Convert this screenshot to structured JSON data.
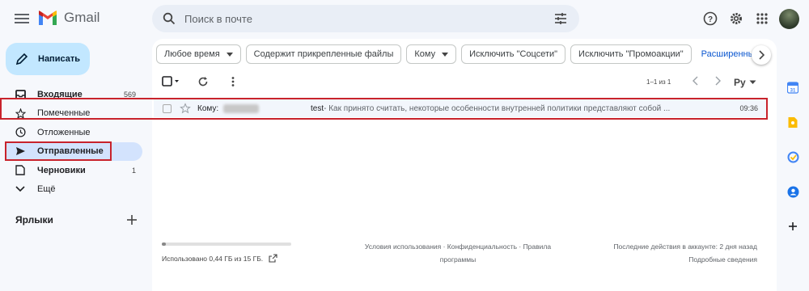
{
  "app": {
    "name": "Gmail"
  },
  "search": {
    "placeholder": "Поиск в почте"
  },
  "compose": {
    "label": "Написать"
  },
  "sidebar": {
    "items": [
      {
        "label": "Входящие",
        "count": "569",
        "icon": "inbox-icon"
      },
      {
        "label": "Помеченные",
        "count": "",
        "icon": "star-icon"
      },
      {
        "label": "Отложенные",
        "count": "",
        "icon": "clock-icon"
      },
      {
        "label": "Отправленные",
        "count": "",
        "icon": "send-icon"
      },
      {
        "label": "Черновики",
        "count": "1",
        "icon": "draft-icon"
      },
      {
        "label": "Ещё",
        "count": "",
        "icon": "chevron-down-icon"
      }
    ],
    "labels_heading": "Ярлыки"
  },
  "filters": {
    "chips": [
      {
        "label": "Любое время",
        "dropdown": true
      },
      {
        "label": "Содержит прикрепленные файлы",
        "dropdown": false
      },
      {
        "label": "Кому",
        "dropdown": true
      },
      {
        "label": "Исключить \"Соцсети\"",
        "dropdown": false
      },
      {
        "label": "Исключить \"Промоакции\"",
        "dropdown": false
      }
    ],
    "advanced_link": "Расширенны"
  },
  "toolbar": {
    "pager": "1–1 из 1",
    "input_tool": "Ру"
  },
  "messages": [
    {
      "to_label": "Кому:",
      "subject": "test",
      "snippet": " - Как принято считать, некоторые особенности внутренней политики представляют собой ...",
      "time": "09:36"
    }
  ],
  "footer": {
    "storage_used_text": "Использовано 0,44 ГБ из 15 ГБ.",
    "storage_fraction": 0.03,
    "terms_line1": "Условия использования · Конфиденциальность · Правила",
    "terms_line2": "программы",
    "activity_line1": "Последние действия в аккаунте: 2 дня назад",
    "activity_line2": "Подробные сведения"
  },
  "colors": {
    "accent": "#c2e7ff",
    "active_nav": "#d3e3fd",
    "highlight_border": "#c8232c",
    "link": "#0b57d0"
  }
}
